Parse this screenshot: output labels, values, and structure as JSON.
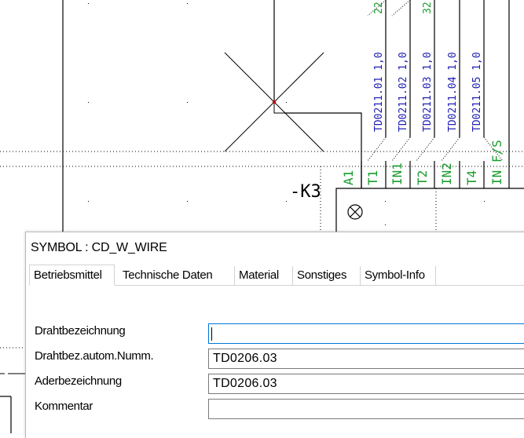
{
  "cad": {
    "wire_labels": [
      "TD0211.01 1,0",
      "TD0211.02 1,0",
      "TD0211.03 1,0",
      "TD0211.04 1,0",
      "TD0211.05 1,0"
    ],
    "top_fragments": [
      "22",
      "32"
    ],
    "terminal_labels": [
      "A1",
      "T1",
      "IN1",
      "T2",
      "IN2",
      "T4",
      "IN F/S"
    ],
    "device_tag": "-K3",
    "colors": {
      "green": "#1a9c2e",
      "blue": "#1e1eb4",
      "grid": "#000000"
    }
  },
  "dialog": {
    "title": "SYMBOL : CD_W_WIRE",
    "tabs": [
      "Betriebsmittel",
      "Technische Daten",
      "Material",
      "Sonstiges",
      "Symbol-Info"
    ],
    "active_tab": "Betriebsmittel",
    "fields": {
      "drahtbezeichnung": {
        "label": "Drahtbezeichnung",
        "value": ""
      },
      "drahtbez_autom": {
        "label": "Drahtbez.autom.Numm.",
        "value": "TD0206.03"
      },
      "aderbezeichnung": {
        "label": "Aderbezeichnung",
        "value": "TD0206.03"
      },
      "kommentar": {
        "label": "Kommentar",
        "value": ""
      }
    }
  }
}
